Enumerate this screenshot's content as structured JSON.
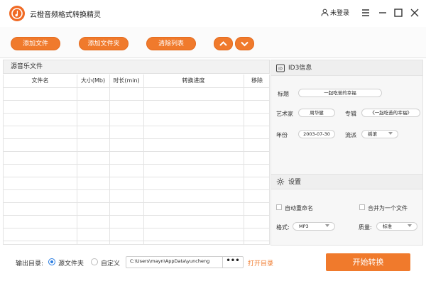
{
  "app": {
    "title": "云橙音频格式转换精灵",
    "login": "未登录"
  },
  "toolbar": {
    "add_file": "添加文件",
    "add_folder": "添加文件夹",
    "clear_list": "清除列表"
  },
  "list": {
    "header": "源音乐文件",
    "columns": [
      "文件名",
      "大小(Mb)",
      "时长(min)",
      "转换进度",
      "移除"
    ]
  },
  "id3": {
    "header": "ID3信息",
    "title_label": "标题",
    "title_value": "一起吃苦的幸福",
    "artist_label": "艺术家",
    "artist_value": "周华健",
    "album_label": "专辑",
    "album_value": "《一起吃苦的幸福》",
    "year_label": "年份",
    "year_value": "2003-07-30",
    "genre_label": "流派",
    "genre_value": "摇滚"
  },
  "settings": {
    "header": "设置",
    "auto_rename": "自动重命名",
    "merge": "合并为一个文件",
    "format_label": "格式:",
    "format_value": "MP3",
    "quality_label": "质量:",
    "quality_value": "标准"
  },
  "output": {
    "label": "输出目录:",
    "opt_source": "源文件夹",
    "opt_custom": "自定义",
    "path": "C:\\Users\\mayn\\AppData\\yuncheng",
    "browse": "•••",
    "open_dir": "打开目录"
  },
  "start": "开始转换",
  "colors": {
    "accent": "#f07a2c",
    "link": "#f07a2c",
    "radio": "#2a7de1"
  }
}
